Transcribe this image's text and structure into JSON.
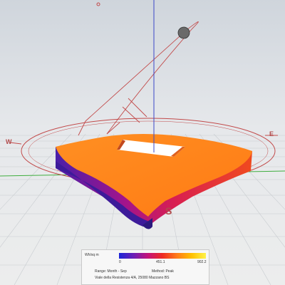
{
  "compass": {
    "east_label": "E",
    "south_label": "S",
    "west_label": "W"
  },
  "legend": {
    "unit": "Wh/sq m",
    "tick_min": "0",
    "tick_mid": "451.1",
    "tick_max": "902.2",
    "range": "Range: Month - Sep",
    "method": "Method: Peak",
    "address": "Viale della Resistenza 4/A, 25080 Mazzano BS"
  },
  "colors": {
    "roof": "#ff8a1d",
    "compass_line": "#c24a4a",
    "axis_blue": "#3b47c8",
    "axis_green": "#3fae3f"
  }
}
